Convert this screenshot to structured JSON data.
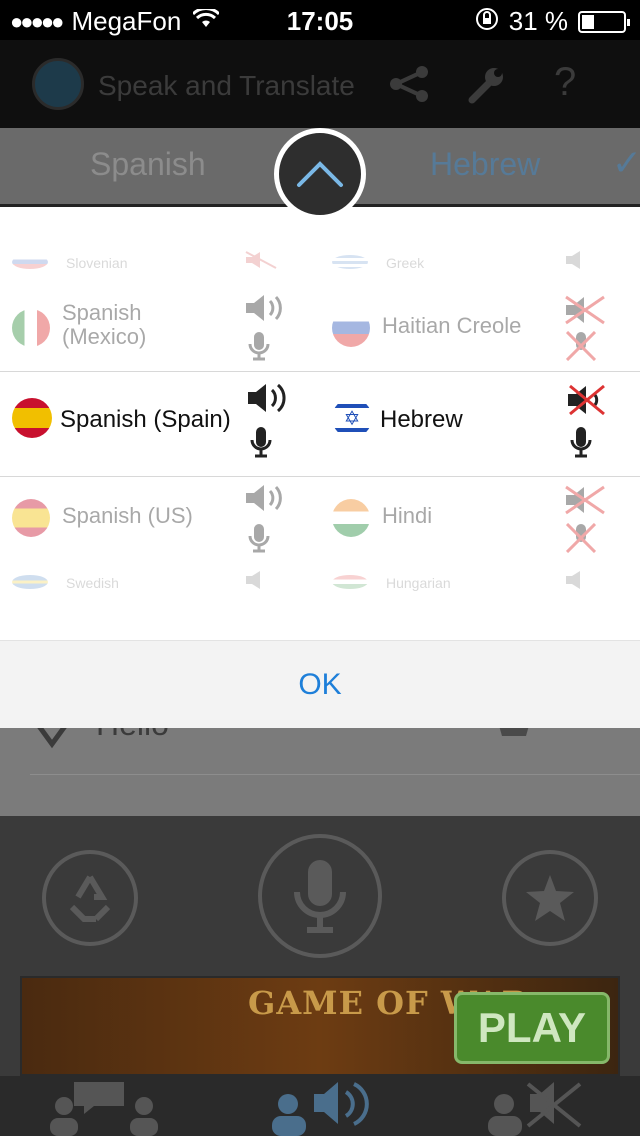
{
  "status": {
    "signal": "●●●●●",
    "carrier": "MegaFon",
    "time": "17:05",
    "battery": "31 %",
    "battery_level": 0.31
  },
  "app": {
    "title": "Speak and Translate"
  },
  "lang_bar": {
    "source": "Spanish",
    "target": "Hebrew"
  },
  "picker": {
    "rows": [
      {
        "left": "Slovenian",
        "right": "Greek"
      },
      {
        "left": "Spanish\n(Mexico)",
        "right": "Haitian Creole"
      },
      {
        "left": "Spanish (Spain)",
        "right": "Hebrew"
      },
      {
        "left": "Spanish (US)",
        "right": "Hindi"
      },
      {
        "left": "Swedish",
        "right": "Hungarian"
      }
    ]
  },
  "ok_label": "OK",
  "background": {
    "phrase": "Hello"
  },
  "ad": {
    "title": "GAME OF WAR",
    "cta": "PLAY"
  },
  "colors": {
    "accent": "#1e7fd9",
    "unsupported": "#d9534f"
  }
}
